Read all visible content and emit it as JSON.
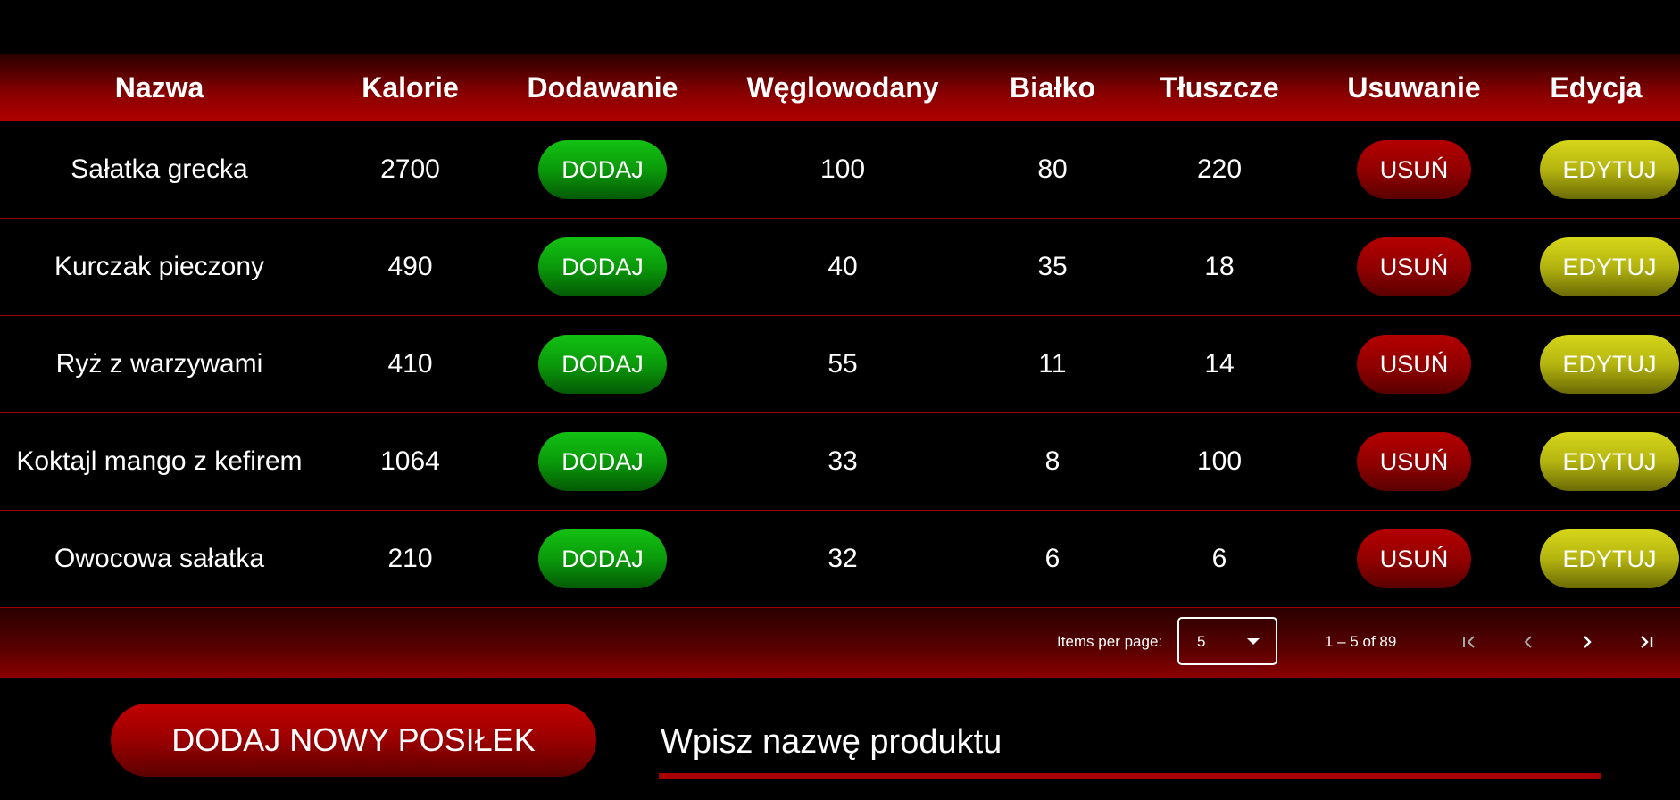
{
  "table": {
    "headers": {
      "name": "Nazwa",
      "calories": "Kalorie",
      "add": "Dodawanie",
      "carbs": "Węglowodany",
      "protein": "Białko",
      "fat": "Tłuszcze",
      "delete": "Usuwanie",
      "edit": "Edycja"
    },
    "rows": [
      {
        "name": "Sałatka grecka",
        "calories": "2700",
        "carbs": "100",
        "protein": "80",
        "fat": "220"
      },
      {
        "name": "Kurczak pieczony",
        "calories": "490",
        "carbs": "40",
        "protein": "35",
        "fat": "18"
      },
      {
        "name": "Ryż z warzywami",
        "calories": "410",
        "carbs": "55",
        "protein": "11",
        "fat": "14"
      },
      {
        "name": "Koktajl mango z kefirem",
        "calories": "1064",
        "carbs": "33",
        "protein": "8",
        "fat": "100"
      },
      {
        "name": "Owocowa sałatka",
        "calories": "210",
        "carbs": "32",
        "protein": "6",
        "fat": "6"
      }
    ],
    "add_label": "DODAJ",
    "delete_label": "USUŃ",
    "edit_label": "EDYTUJ"
  },
  "paginator": {
    "items_per_page_label": "Items per page:",
    "items_per_page_value": "5",
    "range_label": "1 – 5 of 89",
    "icons": {
      "first": "first-page-icon",
      "prev": "chevron-left-icon",
      "next": "chevron-right-icon",
      "last": "last-page-icon"
    }
  },
  "actions": {
    "add_new_meal": "DODAJ NOWY POSIŁEK"
  },
  "search": {
    "placeholder": "Wpisz nazwę produktu",
    "value": ""
  },
  "colors": {
    "background": "#000000",
    "accent_red": "#a80000",
    "add_green": "#0a9a0a",
    "edit_yellow": "#b4b410"
  }
}
